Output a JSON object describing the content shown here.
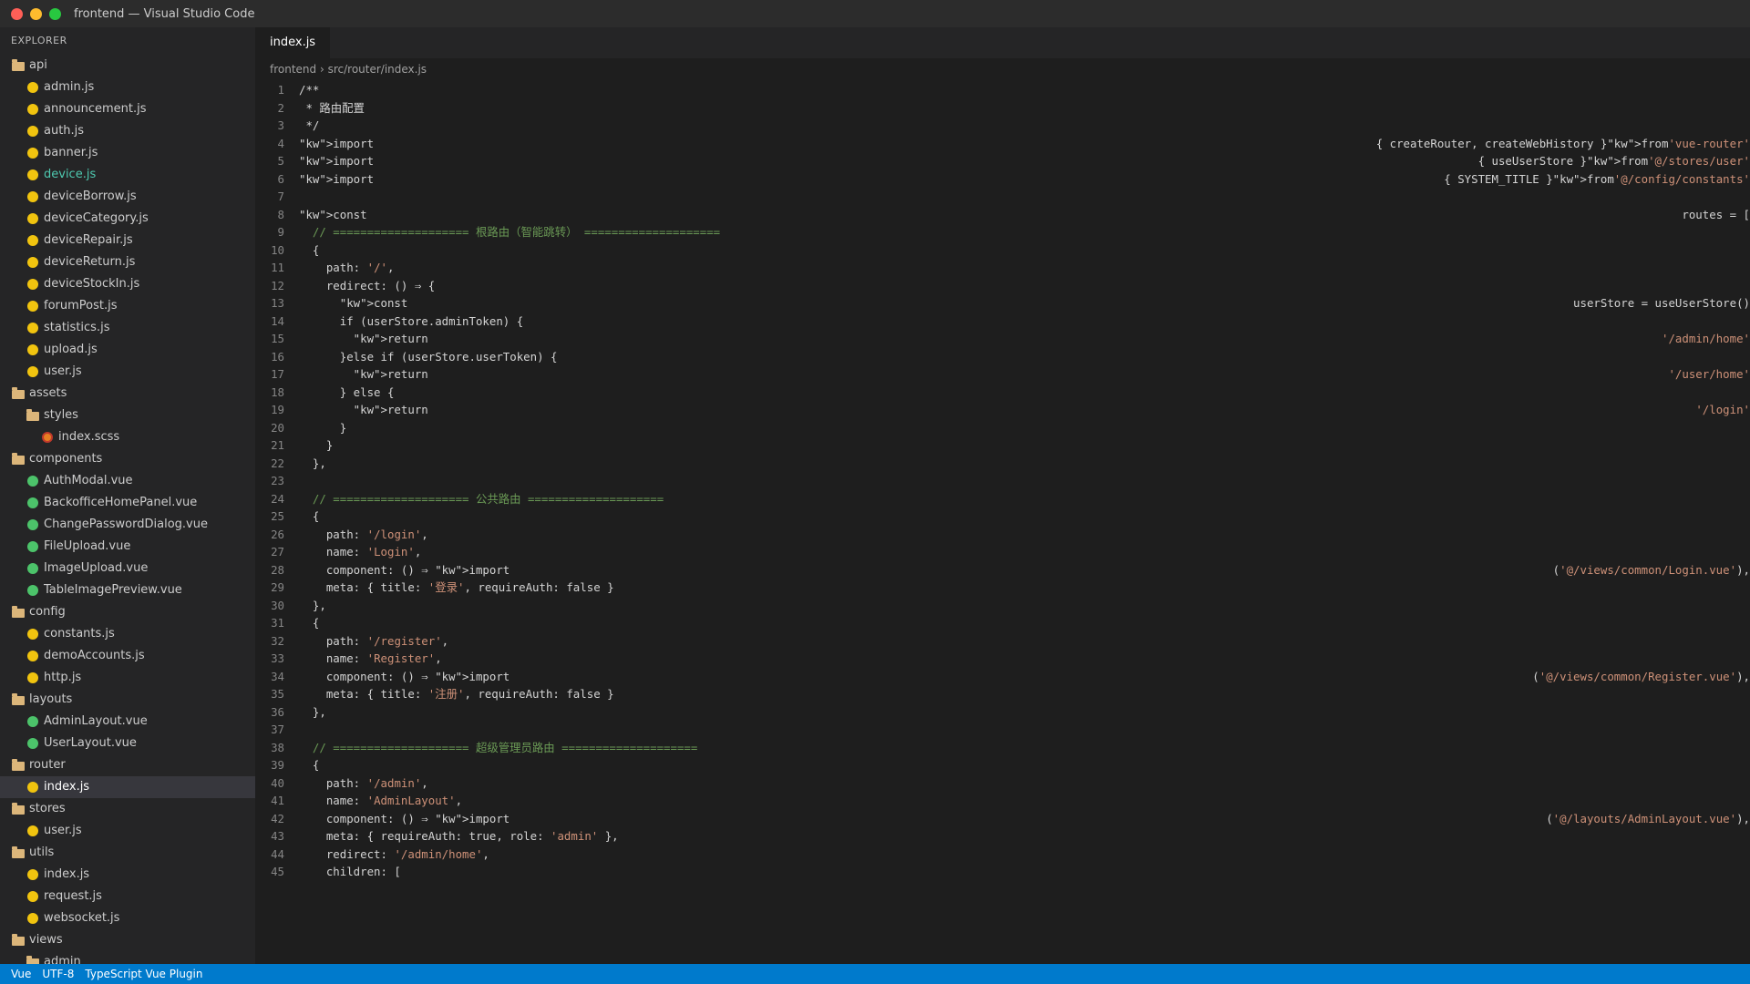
{
  "window": {
    "title": "frontend — Visual Studio Code"
  },
  "explorer": {
    "header": "EXPLORER",
    "items": [
      {
        "label": "api",
        "type": "folder",
        "depth": 0
      },
      {
        "label": "admin.js",
        "type": "js",
        "depth": 1
      },
      {
        "label": "announcement.js",
        "type": "js",
        "depth": 1
      },
      {
        "label": "auth.js",
        "type": "js",
        "depth": 1
      },
      {
        "label": "banner.js",
        "type": "js",
        "depth": 1
      },
      {
        "label": "device.js",
        "type": "js",
        "depth": 1,
        "highlight": true
      },
      {
        "label": "deviceBorrow.js",
        "type": "js",
        "depth": 1
      },
      {
        "label": "deviceCategory.js",
        "type": "js",
        "depth": 1
      },
      {
        "label": "deviceRepair.js",
        "type": "js",
        "depth": 1
      },
      {
        "label": "deviceReturn.js",
        "type": "js",
        "depth": 1
      },
      {
        "label": "deviceStockIn.js",
        "type": "js",
        "depth": 1
      },
      {
        "label": "forumPost.js",
        "type": "js",
        "depth": 1
      },
      {
        "label": "statistics.js",
        "type": "js",
        "depth": 1
      },
      {
        "label": "upload.js",
        "type": "js",
        "depth": 1
      },
      {
        "label": "user.js",
        "type": "js",
        "depth": 1
      },
      {
        "label": "assets",
        "type": "folder",
        "depth": 0
      },
      {
        "label": "styles",
        "type": "folder",
        "depth": 1
      },
      {
        "label": "index.scss",
        "type": "scss",
        "depth": 2
      },
      {
        "label": "components",
        "type": "folder",
        "depth": 0
      },
      {
        "label": "AuthModal.vue",
        "type": "vue",
        "depth": 1
      },
      {
        "label": "BackofficeHomePanel.vue",
        "type": "vue",
        "depth": 1
      },
      {
        "label": "ChangePasswordDialog.vue",
        "type": "vue",
        "depth": 1
      },
      {
        "label": "FileUpload.vue",
        "type": "vue",
        "depth": 1
      },
      {
        "label": "ImageUpload.vue",
        "type": "vue",
        "depth": 1
      },
      {
        "label": "TableImagePreview.vue",
        "type": "vue",
        "depth": 1
      },
      {
        "label": "config",
        "type": "folder",
        "depth": 0
      },
      {
        "label": "constants.js",
        "type": "js",
        "depth": 1
      },
      {
        "label": "demoAccounts.js",
        "type": "js",
        "depth": 1
      },
      {
        "label": "http.js",
        "type": "js",
        "depth": 1
      },
      {
        "label": "layouts",
        "type": "folder",
        "depth": 0
      },
      {
        "label": "AdminLayout.vue",
        "type": "vue",
        "depth": 1
      },
      {
        "label": "UserLayout.vue",
        "type": "vue",
        "depth": 1
      },
      {
        "label": "router",
        "type": "folder",
        "depth": 0
      },
      {
        "label": "index.js",
        "type": "js",
        "depth": 1,
        "active": true
      },
      {
        "label": "stores",
        "type": "folder",
        "depth": 0
      },
      {
        "label": "user.js",
        "type": "js",
        "depth": 1
      },
      {
        "label": "utils",
        "type": "folder",
        "depth": 0
      },
      {
        "label": "index.js",
        "type": "js",
        "depth": 1
      },
      {
        "label": "request.js",
        "type": "js",
        "depth": 1
      },
      {
        "label": "websocket.js",
        "type": "js",
        "depth": 1
      },
      {
        "label": "views",
        "type": "folder",
        "depth": 0
      },
      {
        "label": "admin",
        "type": "folder",
        "depth": 1
      }
    ]
  },
  "editor": {
    "tab": "index.js",
    "breadcrumb": "frontend › src/router/index.js",
    "lines": [
      {
        "n": "1",
        "text": "/**",
        "cls": ""
      },
      {
        "n": "2",
        "text": " * 路由配置",
        "cls": ""
      },
      {
        "n": "3",
        "text": " */",
        "cls": ""
      },
      {
        "n": "4",
        "text": "\"kw\">import",
        "right": "{ createRouter, createWebHistory }\"kw\">from",
        "rightStr": "'vue-router'"
      },
      {
        "n": "5",
        "text": "\"kw\">import",
        "right": "{ useUserStore }\"kw\">from",
        "rightStr": "'@/stores/user'"
      },
      {
        "n": "6",
        "text": "\"kw\">import",
        "right": "{ SYSTEM_TITLE }\"kw\">from",
        "rightStr": "'@/config/constants'"
      },
      {
        "n": "7",
        "text": "",
        "cls": ""
      },
      {
        "n": "8",
        "text": "\"kw\">const",
        "right": "routes = [",
        "rightStr": ""
      },
      {
        "n": "9",
        "text": "  // ==================== 根路由（智能跳转） ====================",
        "cls": "cm"
      },
      {
        "n": "10",
        "text": "  {",
        "cls": ""
      },
      {
        "n": "11",
        "text": "    path: ",
        "str": "'/'",
        "after": ","
      },
      {
        "n": "12",
        "text": "    redirect: () ⇒ {",
        "cls": ""
      },
      {
        "n": "13",
        "text": "      \"kw\">const",
        "right": "userStore = useUserStore()",
        "rightStr": ""
      },
      {
        "n": "14",
        "text": "      if (userStore.adminToken) {",
        "cls": ""
      },
      {
        "n": "15",
        "text": "        \"kw\">return",
        "right": "",
        "rightStr": "'/admin/home'"
      },
      {
        "n": "16",
        "text": "      }else if (userStore.userToken) {",
        "cls": ""
      },
      {
        "n": "17",
        "text": "        \"kw\">return",
        "right": "",
        "rightStr": "'/user/home'"
      },
      {
        "n": "18",
        "text": "      } else {",
        "cls": ""
      },
      {
        "n": "19",
        "text": "        \"kw\">return",
        "right": "",
        "rightStr": "'/login'"
      },
      {
        "n": "20",
        "text": "      }",
        "cls": ""
      },
      {
        "n": "21",
        "text": "    }",
        "cls": ""
      },
      {
        "n": "22",
        "text": "  },",
        "cls": ""
      },
      {
        "n": "23",
        "text": "",
        "cls": ""
      },
      {
        "n": "24",
        "text": "  // ==================== 公共路由 ====================",
        "cls": "cm"
      },
      {
        "n": "25",
        "text": "  {",
        "cls": ""
      },
      {
        "n": "26",
        "text": "    path: ",
        "str": "'/login'",
        "after": ","
      },
      {
        "n": "27",
        "text": "    name: ",
        "str": "'Login'",
        "after": ","
      },
      {
        "n": "28",
        "text": "    component: () ⇒ \"kw\">import",
        "right": "(",
        "rightStr": "'@/views/common/Login.vue'",
        "rightAfter": "),"
      },
      {
        "n": "29",
        "text": "    meta: { title: ",
        "str": "'登录'",
        "after": ", requireAuth: false }"
      },
      {
        "n": "30",
        "text": "  },",
        "cls": ""
      },
      {
        "n": "31",
        "text": "  {",
        "cls": ""
      },
      {
        "n": "32",
        "text": "    path: ",
        "str": "'/register'",
        "after": ","
      },
      {
        "n": "33",
        "text": "    name: ",
        "str": "'Register'",
        "after": ","
      },
      {
        "n": "34",
        "text": "    component: () ⇒ \"kw\">import",
        "right": "(",
        "rightStr": "'@/views/common/Register.vue'",
        "rightAfter": "),"
      },
      {
        "n": "35",
        "text": "    meta: { title: ",
        "str": "'注册'",
        "after": ", requireAuth: false }"
      },
      {
        "n": "36",
        "text": "  },",
        "cls": ""
      },
      {
        "n": "37",
        "text": "",
        "cls": ""
      },
      {
        "n": "38",
        "text": "  // ==================== 超级管理员路由 ====================",
        "cls": "cm"
      },
      {
        "n": "39",
        "text": "  {",
        "cls": ""
      },
      {
        "n": "40",
        "text": "    path: ",
        "str": "'/admin'",
        "after": ","
      },
      {
        "n": "41",
        "text": "    name: ",
        "str": "'AdminLayout'",
        "after": ","
      },
      {
        "n": "42",
        "text": "    component: () ⇒ \"kw\">import",
        "right": "(",
        "rightStr": "'@/layouts/AdminLayout.vue'",
        "rightAfter": "),"
      },
      {
        "n": "43",
        "text": "    meta: { requireAuth: true, role: ",
        "str": "'admin'",
        "after": " },"
      },
      {
        "n": "44",
        "text": "    redirect: ",
        "str": "'/admin/home'",
        "after": ","
      },
      {
        "n": "45",
        "text": "    children: [",
        "cls": ""
      }
    ]
  },
  "statusbar": {
    "language": "Vue",
    "encoding": "UTF-8",
    "plugin": "TypeScript Vue Plugin"
  }
}
